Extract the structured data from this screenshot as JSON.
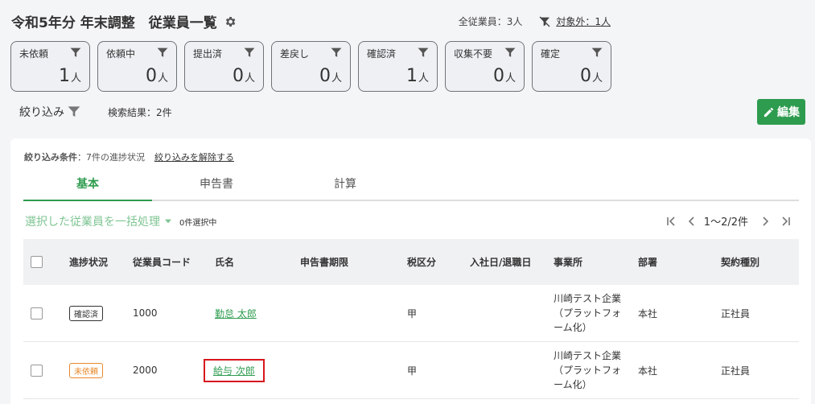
{
  "header": {
    "title": "令和5年分 年末調整　従業員一覧",
    "total_employees": "全従業員：3人",
    "excluded_link": "対象外：1人"
  },
  "status_cards": [
    {
      "label": "未依頼",
      "count": "1",
      "unit": "人"
    },
    {
      "label": "依頼中",
      "count": "0",
      "unit": "人"
    },
    {
      "label": "提出済",
      "count": "0",
      "unit": "人"
    },
    {
      "label": "差戻し",
      "count": "0",
      "unit": "人"
    },
    {
      "label": "確認済",
      "count": "1",
      "unit": "人"
    },
    {
      "label": "収集不要",
      "count": "0",
      "unit": "人"
    },
    {
      "label": "確定",
      "count": "0",
      "unit": "人"
    }
  ],
  "filter": {
    "label": "絞り込み",
    "search_result": "検索結果：2件"
  },
  "edit_button": "編集",
  "condition": {
    "key": "絞り込み条件",
    "value": "：7件の進捗状況",
    "clear_link": "絞り込みを解除する"
  },
  "tabs": [
    "基本",
    "申告書",
    "計算"
  ],
  "bulk": {
    "label": "選択した従業員を一括処理",
    "selected": "0件選択中"
  },
  "pager": {
    "range": "1〜2/2件"
  },
  "table": {
    "headers": [
      "進捗状況",
      "従業員コード",
      "氏名",
      "申告書期限",
      "税区分",
      "入社日/退職日",
      "事業所",
      "部署",
      "契約種別"
    ],
    "rows": [
      {
        "status": "確認済",
        "code": "1000",
        "name": "勤怠 太郎",
        "deadline": "",
        "tax": "甲",
        "date": "",
        "office_lines": [
          "川崎テスト企業",
          "（プラットフォ",
          "ーム化）"
        ],
        "dept": "本社",
        "contract": "正社員"
      },
      {
        "status": "未依頼",
        "code": "2000",
        "name": "給与 次郎",
        "deadline": "",
        "tax": "甲",
        "date": "",
        "office_lines": [
          "川崎テスト企業",
          "（プラットフォ",
          "ーム化）"
        ],
        "dept": "本社",
        "contract": "正社員"
      }
    ]
  },
  "colors": {
    "accent": "#2e9c4f",
    "unrequested": "#e8892b",
    "highlight": "#d6171d"
  }
}
